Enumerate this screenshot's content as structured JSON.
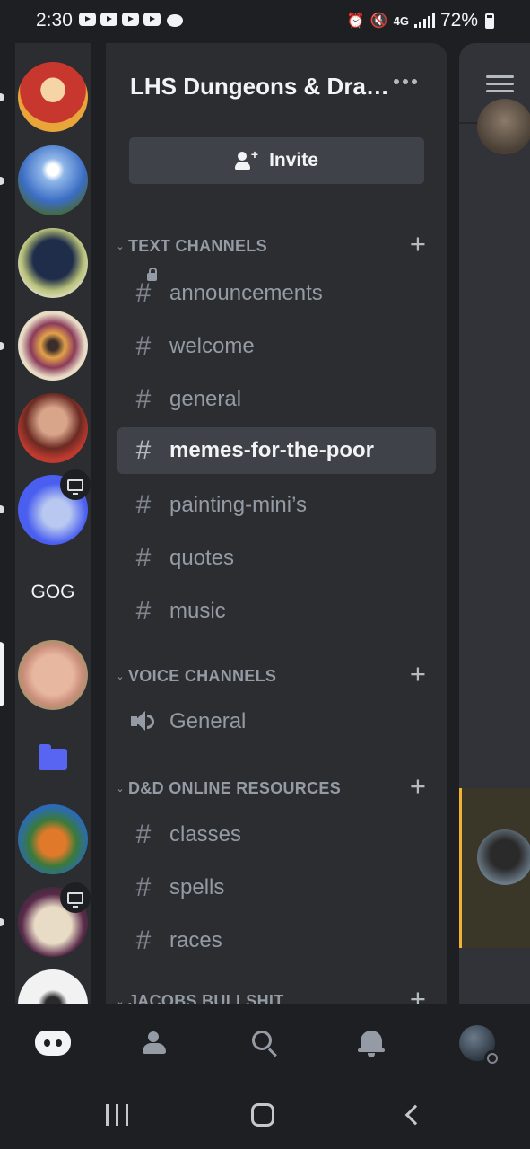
{
  "status_bar": {
    "time": "2:30",
    "battery": "72%",
    "network": "4G"
  },
  "server_rail": {
    "gog_label": "GOG"
  },
  "server": {
    "name": "LHS Dungeons & Dragons",
    "invite_label": "Invite"
  },
  "categories": [
    {
      "label": "TEXT CHANNELS",
      "channels": [
        "announcements",
        "welcome",
        "general",
        "memes-for-the-poor",
        "painting-mini’s",
        "quotes",
        "music"
      ]
    },
    {
      "label": "VOICE CHANNELS",
      "channels": [
        "General"
      ]
    },
    {
      "label": "D&D ONLINE RESOURCES",
      "channels": [
        "classes",
        "spells",
        "races"
      ]
    },
    {
      "label": "JACOBS BULLSHIT"
    }
  ],
  "active_channel": "memes-for-the-poor",
  "colors": {
    "accent": "#5865f2",
    "background": "#1e1f22",
    "panel": "#2b2d31",
    "selected": "#404249",
    "muted_text": "#949ba4",
    "mention_highlight": "#f0b232"
  },
  "icons": {
    "channel": "hash-icon",
    "locked_channel": "hash-lock-icon",
    "voice": "speaker-icon",
    "invite": "person-add-icon",
    "nav": [
      "discord-home-icon",
      "friends-icon",
      "search-icon",
      "bell-icon",
      "profile-avatar"
    ]
  }
}
